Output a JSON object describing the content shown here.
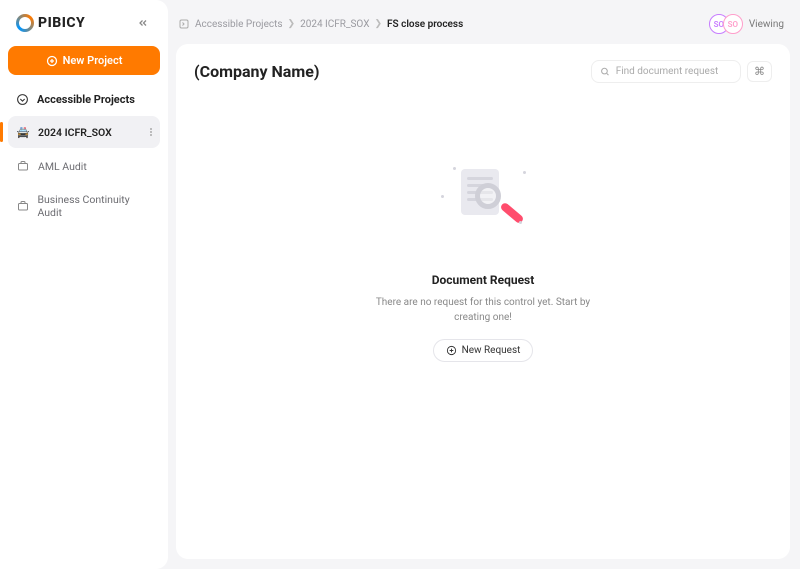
{
  "brand": {
    "name": "PIBICY"
  },
  "sidebar": {
    "new_project_label": "New Project",
    "section_title": "Accessible Projects",
    "items": [
      {
        "label": "2024 ICFR_SOX",
        "icon": "police-car-icon",
        "active": true
      },
      {
        "label": "AML Audit",
        "icon": "briefcase-icon",
        "active": false
      },
      {
        "label": "Business Continuity Audit",
        "icon": "briefcase-icon",
        "active": false
      }
    ]
  },
  "breadcrumbs": {
    "items": [
      {
        "label": "Accessible Projects"
      },
      {
        "label": "2024 ICFR_SOX"
      },
      {
        "label": "FS close process",
        "current": true
      }
    ]
  },
  "viewing": {
    "label": "Viewing",
    "avatars": [
      {
        "initials": "SO"
      },
      {
        "initials": "SO"
      }
    ]
  },
  "header": {
    "company_name": "(Company Name)"
  },
  "search": {
    "placeholder": "Find document request",
    "shortcut": "⌘"
  },
  "empty_state": {
    "title": "Document Request",
    "subtitle": "There are no request for this control yet. Start by creating one!",
    "button_label": "New Request"
  }
}
